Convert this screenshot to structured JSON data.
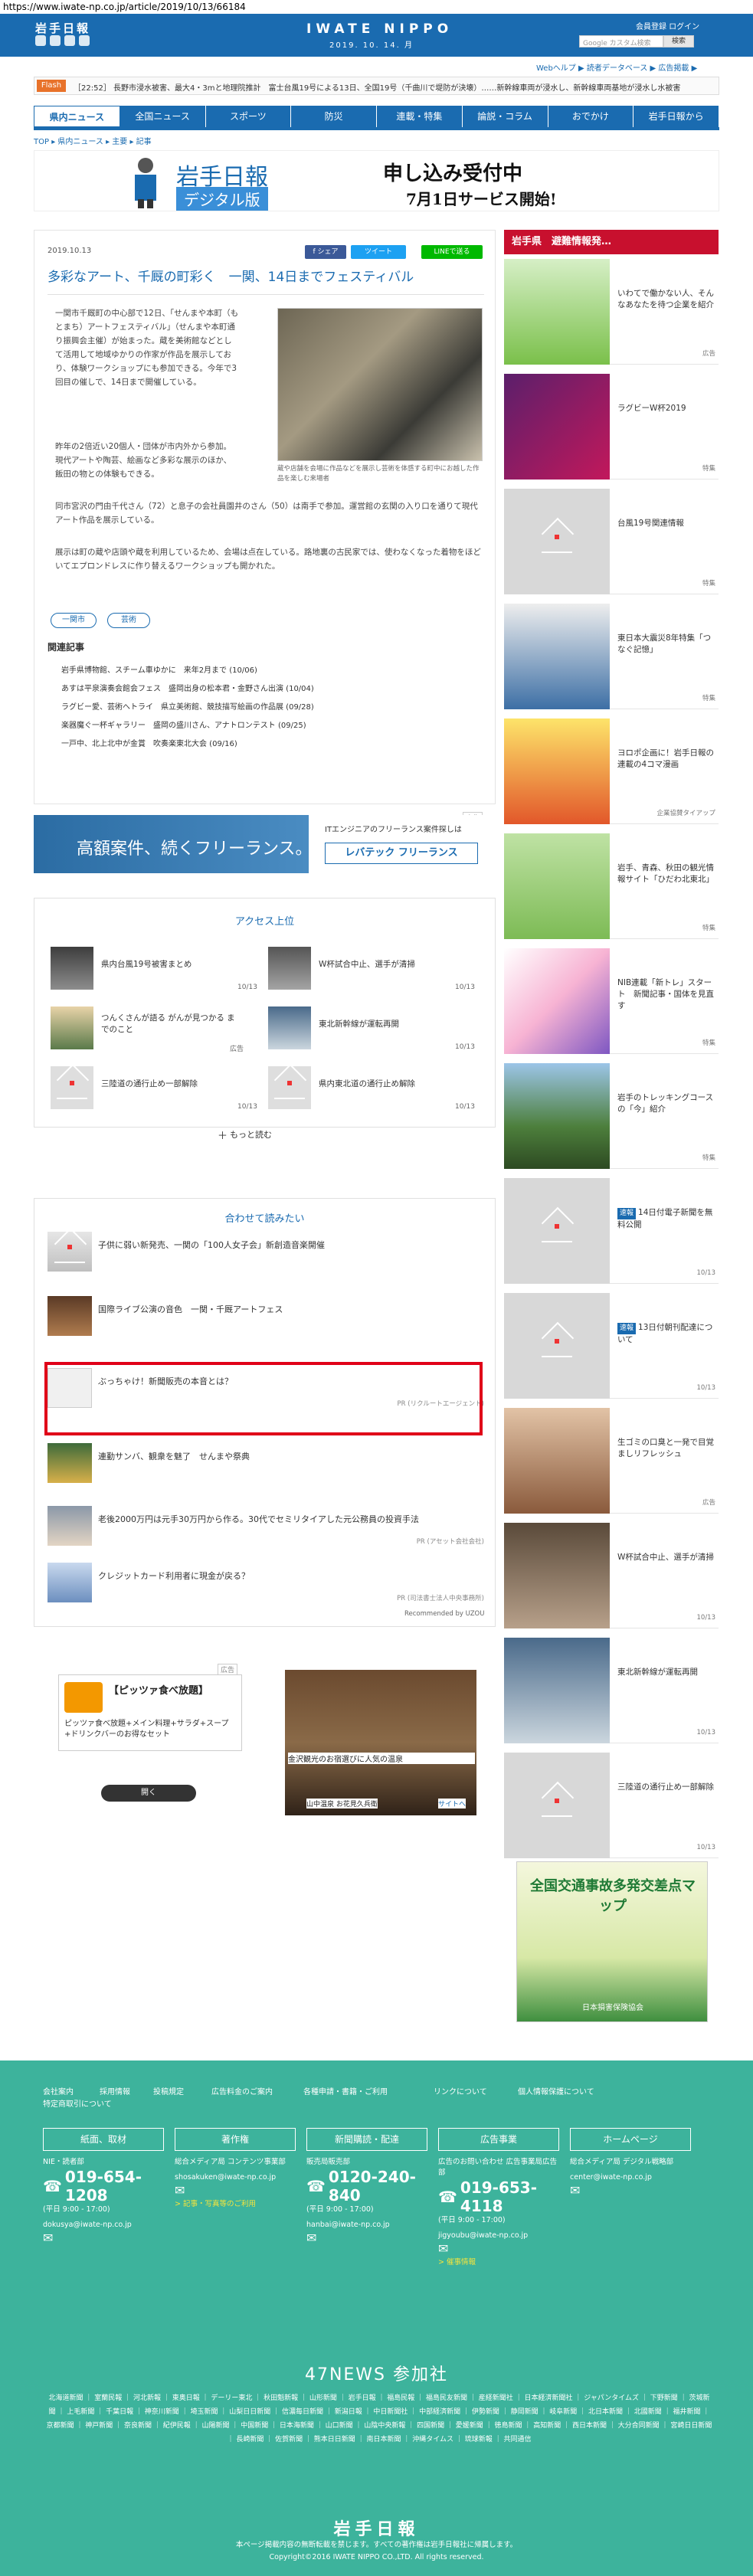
{
  "url": "https://www.iwate-np.co.jp/article/2019/10/13/66184",
  "header": {
    "logo": "岩手日報",
    "brand": "IWATE NIPPO",
    "date": "2019. 10. 14. 月",
    "links": "会員登録  ログイン",
    "search_placeholder": "Google カスタム検索",
    "search_button": "検索",
    "sub_links": "Webヘルプ ▶  読者データベース ▶  広告掲載 ▶"
  },
  "flash": {
    "badge": "Flash",
    "text": "［22:52］ 長野市浸水被害、最大4・3mと地理院推計　富士台風19号による13日、全国19号（千曲川で堤防が決壊）……新幹線車両が浸水し、新幹線車両基地が浸水し水被害"
  },
  "nav": [
    "県内ニュース",
    "全国ニュース",
    "スポーツ",
    "防災",
    "連載・特集",
    "論説・コラム",
    "おでかけ",
    "岩手日報から"
  ],
  "breadcrumb": "TOP ▸ 県内ニュース ▸ 主要 ▸ 記事",
  "banner": {
    "logo": "岩手日報",
    "sub": "デジタル版",
    "title": "申し込み受付中",
    "subtitle": "7月1日サービス開始!"
  },
  "article": {
    "date": "2019.10.13",
    "share": [
      "f シェア",
      "ツイート",
      "LINEで送る"
    ],
    "title": "多彩なアート、千厩の町彩く　一関、14日までフェスティバル",
    "para1": "一関市千厩町の中心部で12日、「せんまや本町（もとまち）アートフェスティバル」（せんまや本町通り振興会主催）が始まった。蔵を美術館などとして活用して地域ゆかりの作家が作品を展示しており、体験ワークショップにも参加できる。今年で3回目の催しで、14日まで開催している。",
    "para2": "昨年の2倍近い20個人・団体が市内外から参加。現代アートや陶芸、絵画など多彩な展示のほか、飯田の物との体験もできる。",
    "para3": "同市宮沢の門由千代さん（72）と息子の会社員園井のさん（50）は南手で参加。運営館の玄関の入り口を通りて現代アート作品を展示している。",
    "para4": "展示は町の蔵や店頭や蔵を利用しているため、会場は点在している。路地裏の古民家では、使わなくなった着物をほどいてエプロンドレスに作り替えるワークショップも開かれた。",
    "photo_caption": "蔵や店舗を会場に作品などを展示し芸術を体感する町中にお越した作品を楽しむ来場者",
    "tags": [
      "一関市",
      "芸術"
    ],
    "related_title": "関連記事",
    "related": [
      "岩手県博物館、スチーム車ゆかに　来年2月まで (10/06)",
      "あすは平泉演奏会館会フェス　盛岡出身の松本君・金野さん出演 (10/04)",
      "ラグビー愛、芸術へトライ　県立美術館、競技描写絵画の作品展 (09/28)",
      "楽器魔ぐ一杯ギャラリー　盛岡の盛川さん、アナトロンテスト (09/25)",
      "一戸中、北上北中が金賞　吹奏楽東北大会 (09/16)"
    ]
  },
  "ad_levtech": {
    "headline": "高額案件、続くフリーランス。",
    "right_text": "ITエンジニアのフリーランス案件探しは",
    "logo": "レバテック フリーランス",
    "label": "広告"
  },
  "ranking": {
    "title": "アクセス上位",
    "items": [
      {
        "text": "県内台風19号被害まとめ",
        "date": "10/13"
      },
      {
        "text": "W杯試合中止、選手が清掃",
        "date": "10/13"
      },
      {
        "text": "つんくさんが語る がんが見つかる までのこと",
        "date": "広告"
      },
      {
        "text": "東北新幹線が運転再開",
        "date": "10/13"
      },
      {
        "text": "三陸道の通行止め一部解除",
        "date": "10/13"
      },
      {
        "text": "県内東北道の通行止め解除",
        "date": "10/13"
      }
    ],
    "more": "もっと読む"
  },
  "recommend": {
    "title": "合わせて読みたい",
    "items": [
      {
        "text": "子供に弱い新発売、一関の「100人女子会」新創造音楽開催",
        "pr": ""
      },
      {
        "text": "国際ライブ公演の音色　一関・千厩アートフェス",
        "pr": ""
      },
      {
        "text": "ぶっちゃけ！新聞販売の本音とは？",
        "pr": "PR (リクルートエージェント)"
      },
      {
        "text": "連勤サンバ、観衆を魅了　せんまや祭典",
        "pr": ""
      },
      {
        "text": "老後2000万円は元手30万円から作る。30代でセミリタイアした元公務員の投資手法",
        "pr": "PR (アセット会社会社)"
      },
      {
        "text": "クレジットカード利用者に現金が戻る？",
        "pr": "PR (司法書士法人中央事務所)"
      }
    ],
    "powered": "Recommended by UZOU"
  },
  "ad_pizza": {
    "title": "【ピッツァ食べ放題】",
    "sub": "ピッツァ食べ放題+メイン料理+サラダ+スープ+ドリンクバーのお得なセット",
    "button": "開く",
    "label": "広告"
  },
  "ad_onsen": {
    "text": "金沢観光のお宿選びに人気の温泉",
    "sub": "山中温泉 お花見久兵衛",
    "link": "サイトへ"
  },
  "sidebar": {
    "header": "岩手県　避難情報発…",
    "items": [
      {
        "text": "いわてで働かない人、そんなあなたを待つ企業を紹介",
        "meta": "広告",
        "badge": ""
      },
      {
        "text": "ラグビーW杯2019",
        "meta": "特集",
        "badge": ""
      },
      {
        "text": "台風19号関連情報",
        "meta": "特集",
        "badge": ""
      },
      {
        "text": "東日本大震災8年特集「つなぐ記憶」",
        "meta": "特集",
        "badge": ""
      },
      {
        "text": "ヨロポ企画に！岩手日報の連載の4コマ漫画",
        "meta": "企業協賛タイアップ",
        "badge": ""
      },
      {
        "text": "岩手、青森、秋田の観光情報サイト「ひだわ北東北」",
        "meta": "特集",
        "badge": ""
      },
      {
        "text": "NIB連載「新トレ」スタート　新聞記事・国体を見直す",
        "meta": "特集",
        "badge": ""
      },
      {
        "text": "岩手のトレッキングコースの「今」紹介",
        "meta": "特集",
        "badge": ""
      },
      {
        "text": "14日付電子新聞を無料公開",
        "meta": "10/13",
        "badge": "速報"
      },
      {
        "text": "13日付朝刊配達について",
        "meta": "10/13",
        "badge": "速報"
      },
      {
        "text": "生ゴミの口臭と一発で目覚ましリフレッシュ",
        "meta": "広告",
        "badge": ""
      },
      {
        "text": "W杯試合中止、選手が清掃",
        "meta": "10/13",
        "badge": ""
      },
      {
        "text": "東北新幹線が運転再開",
        "meta": "10/13",
        "badge": ""
      },
      {
        "text": "三陸道の通行止め一部解除",
        "meta": "10/13",
        "badge": ""
      }
    ]
  },
  "ad_traffic": {
    "title": "全国交通事故多発交差点マップ",
    "sponsor": "日本損害保険協会"
  },
  "footer": {
    "links": [
      "会社案内",
      "採用情報",
      "投稿規定",
      "広告料金のご案内",
      "各種申請・書籍・ご利用",
      "リンクについて",
      "個人情報保護について",
      "特定商取引について"
    ],
    "columns": [
      {
        "head": "紙面、取材",
        "sub": "NIE・読者部",
        "tel": "019-654-1208",
        "hours": "(平日 9:00 - 17:00)",
        "mail": "dokusya@iwate-np.co.jp",
        "extra": ""
      },
      {
        "head": "著作権",
        "sub": "総合メディア局 コンテンツ事業部",
        "tel": "",
        "hours": "",
        "mail": "shosakuken@iwate-np.co.jp",
        "extra": "> 記事・写真等のご利用"
      },
      {
        "head": "新聞購読・配達",
        "sub": "販売局販売部",
        "tel": "0120-240-840",
        "hours": "(平日 9:00 - 17:00)",
        "mail": "hanbai@iwate-np.co.jp",
        "extra": ""
      },
      {
        "head": "広告事業",
        "sub": "広告のお問い合わせ 広告事業局広告部",
        "tel": "019-653-4118",
        "hours": "(平日 9:00 - 17:00)",
        "mail": "jigyoubu@iwate-np.co.jp",
        "extra": "> 催事情報"
      },
      {
        "head": "ホームページ",
        "sub": "総合メディア局 デジタル戦略部",
        "tel": "",
        "hours": "",
        "mail": "center@iwate-np.co.jp",
        "extra": ""
      }
    ],
    "news47": "47NEWS 参加社",
    "papers": "北海道新聞 ｜ 室蘭民報 ｜ 河北新報 ｜ 東奥日報 ｜ デーリー東北 ｜ 秋田魁新報 ｜ 山形新聞 ｜ 岩手日報 ｜ 福島民報 ｜ 福島民友新聞 ｜ 産経新聞社 ｜ 日本経済新聞社 ｜ ジャパンタイムズ ｜ 下野新聞 ｜ 茨城新聞 ｜ 上毛新聞 ｜ 千葉日報 ｜ 神奈川新聞 ｜ 埼玉新聞 ｜ 山梨日日新聞 ｜ 信濃毎日新聞 ｜ 新潟日報 ｜ 中日新聞社 ｜ 中部経済新聞 ｜ 伊勢新聞 ｜ 静岡新聞 ｜ 岐阜新聞 ｜ 北日本新聞 ｜ 北國新聞 ｜ 福井新聞 ｜ 京都新聞 ｜ 神戸新聞 ｜ 奈良新聞 ｜ 紀伊民報 ｜ 山陽新聞 ｜ 中国新聞 ｜ 日本海新聞 ｜ 山口新聞 ｜ 山陰中央新報 ｜ 四国新聞 ｜ 愛媛新聞 ｜ 徳島新聞 ｜ 高知新聞 ｜ 西日本新聞 ｜ 大分合同新聞 ｜ 宮崎日日新聞 ｜ 長崎新聞 ｜ 佐賀新聞 ｜ 熊本日日新聞 ｜ 南日本新聞 ｜ 沖縄タイムス ｜ 琉球新報 ｜ 共同通信",
    "logo": "岩手日報",
    "notice": "本ページ掲載内容の無断転載を禁じます。すべての著作権は岩手日報社に帰属します。",
    "copyright": "Copyright©2016 IWATE NIPPO CO.,LTD. All rights reserved."
  },
  "colors": {
    "brand_blue": "#1a6bb0",
    "footer_green": "#3db39c",
    "alert_red": "#c8102e",
    "highlight": "#e00018"
  }
}
